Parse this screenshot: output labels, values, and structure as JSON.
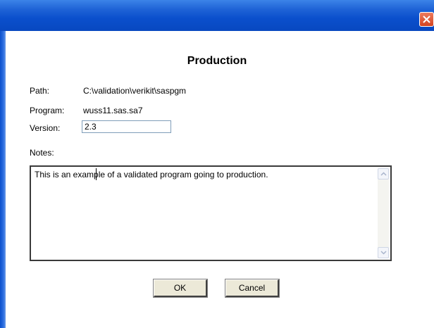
{
  "dialog": {
    "title": "Production",
    "close_icon": "close-x-icon"
  },
  "fields": {
    "path_label": "Path:",
    "path_value": "C:\\validation\\verikit\\saspgm",
    "program_label": "Program:",
    "program_value": "wuss11.sas.sa7",
    "version_label": "Version:",
    "version_value": "2.3",
    "notes_label": "Notes:",
    "notes_value": "This is an example of a validated program going to production."
  },
  "buttons": {
    "ok_label": "OK",
    "cancel_label": "Cancel"
  },
  "colors": {
    "titlebar": "#0a4fcc",
    "close_button": "#d2431f",
    "button_face": "#ece9d8"
  }
}
